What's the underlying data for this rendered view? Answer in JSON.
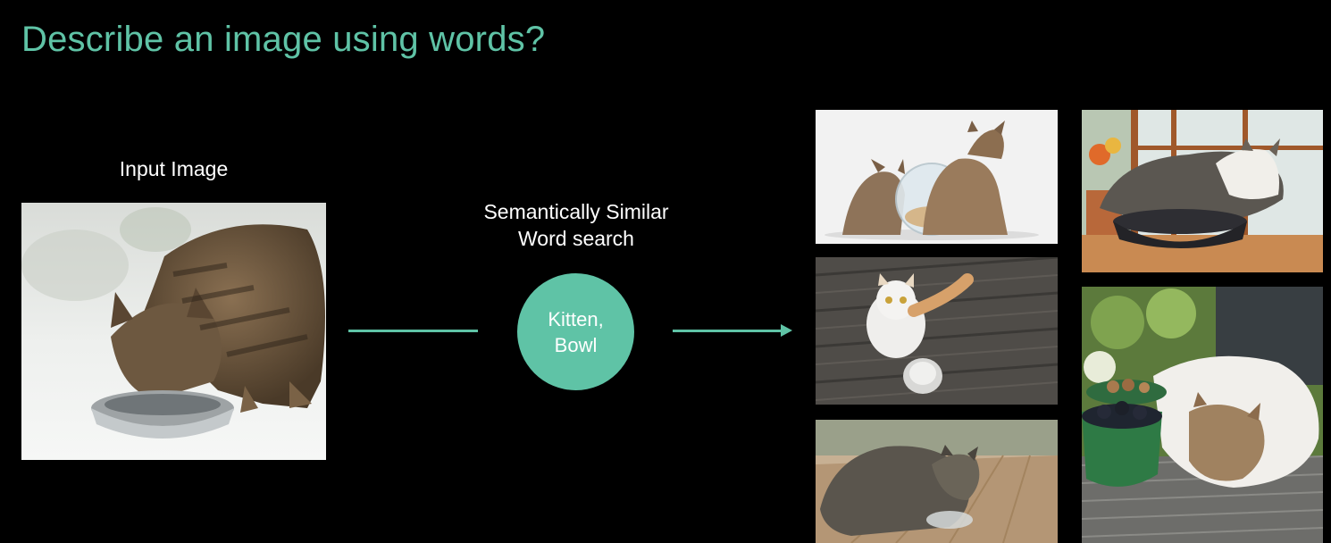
{
  "slide": {
    "title": "Describe an image using words?",
    "input_label": "Input Image",
    "search_label_line1": "Semantically Similar",
    "search_label_line2": "Word search",
    "keywords_line1": "Kitten,",
    "keywords_line2": "Bowl"
  },
  "colors": {
    "accent": "#5fc3a6",
    "background": "#000000",
    "text": "#ffffff"
  }
}
